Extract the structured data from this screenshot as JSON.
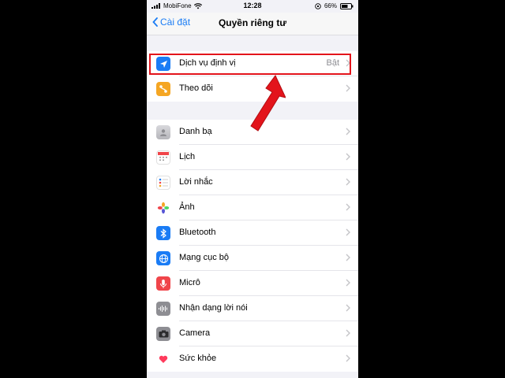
{
  "status_bar": {
    "carrier": "MobiFone",
    "time": "12:28",
    "battery": "66%"
  },
  "nav": {
    "back_label": "Cài đặt",
    "title": "Quyền riêng tư"
  },
  "location_group": [
    {
      "label": "Dịch vụ định vị",
      "value": "Bật",
      "icon": "location-arrow-icon",
      "color": "#1a7cf5"
    },
    {
      "label": "Theo dõi",
      "value": "",
      "icon": "tracking-icon",
      "color": "#f5a623"
    }
  ],
  "apps_group": [
    {
      "label": "Danh bạ",
      "icon": "contacts-icon",
      "color": "#c7c7cc"
    },
    {
      "label": "Lịch",
      "icon": "calendar-icon",
      "color": "#ffffff"
    },
    {
      "label": "Lời nhắc",
      "icon": "reminders-icon",
      "color": "#ffffff"
    },
    {
      "label": "Ảnh",
      "icon": "photos-icon",
      "color": "#ffffff"
    },
    {
      "label": "Bluetooth",
      "icon": "bluetooth-icon",
      "color": "#1a7cf5"
    },
    {
      "label": "Mạng cục bộ",
      "icon": "globe-icon",
      "color": "#1a7cf5"
    },
    {
      "label": "Micrô",
      "icon": "microphone-icon",
      "color": "#f0454a"
    },
    {
      "label": "Nhận dạng lời nói",
      "icon": "speech-waveform-icon",
      "color": "#8e8e93"
    },
    {
      "label": "Camera",
      "icon": "camera-icon",
      "color": "#8e8e93"
    },
    {
      "label": "Sức khỏe",
      "icon": "health-heart-icon",
      "color": "#ffffff"
    }
  ],
  "annotation": {
    "highlight_color": "#e3141b"
  }
}
